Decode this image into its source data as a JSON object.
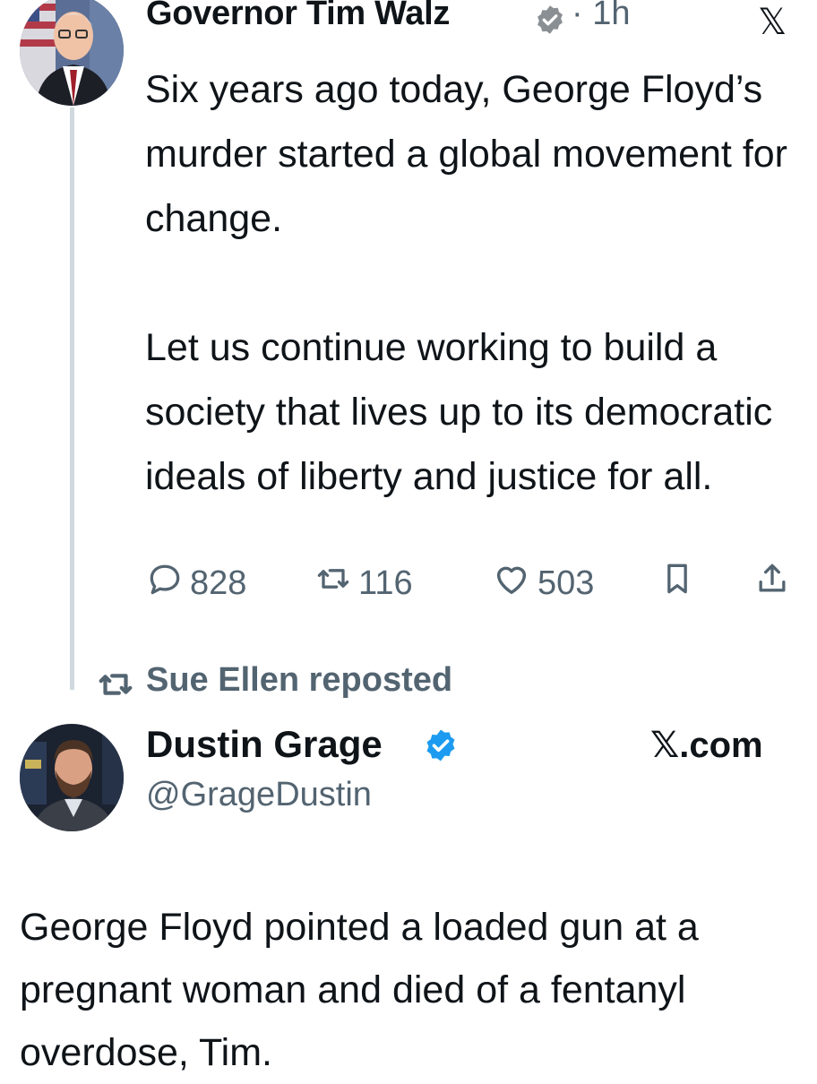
{
  "tweet1": {
    "author_name": "Governor Tim Walz",
    "separator_time": "· 1h",
    "x_logo": "𝕏",
    "paragraphs": [
      "Six years ago today, George Floyd’s murder started a global movement for change.",
      "Let us continue working to build a society that lives up to its democratic ideals of liberty and justice for all."
    ],
    "actions": {
      "replies": "828",
      "reposts": "116",
      "likes": "503"
    }
  },
  "repost": {
    "label": "Sue Ellen reposted"
  },
  "tweet2": {
    "author_name": "Dustin Grage",
    "handle": "@GrageDustin",
    "source": "𝕏.com",
    "text": "George Floyd pointed a loaded gun at a pregnant woman and died of a fentanyl overdose, Tim."
  },
  "colors": {
    "text": "#0f1419",
    "secondary": "#536471",
    "verified_gold": "#8a8f94",
    "verified_blue": "#1d9bf0",
    "thread_line": "#cfd9de"
  },
  "icons": [
    "reply-icon",
    "repost-icon",
    "like-icon",
    "bookmark-icon",
    "share-icon",
    "verified-badge-icon",
    "x-logo-icon"
  ]
}
